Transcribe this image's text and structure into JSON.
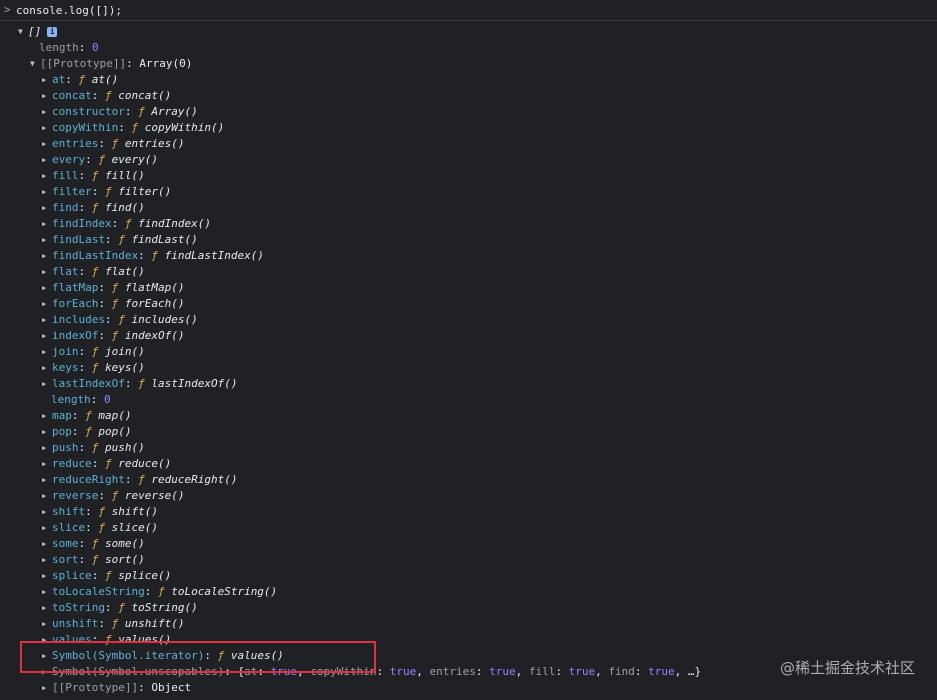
{
  "prompt_symbol": ">",
  "command": "console.log([]);",
  "root": {
    "label": "[]",
    "info_icon": "i"
  },
  "top_length": {
    "key": "length",
    "value": "0"
  },
  "prototype": {
    "key": "[[Prototype]]",
    "value": "Array(0)"
  },
  "methods": [
    {
      "key": "at",
      "fn": "at()"
    },
    {
      "key": "concat",
      "fn": "concat()"
    },
    {
      "key": "constructor",
      "fn": "Array()"
    },
    {
      "key": "copyWithin",
      "fn": "copyWithin()"
    },
    {
      "key": "entries",
      "fn": "entries()"
    },
    {
      "key": "every",
      "fn": "every()"
    },
    {
      "key": "fill",
      "fn": "fill()"
    },
    {
      "key": "filter",
      "fn": "filter()"
    },
    {
      "key": "find",
      "fn": "find()"
    },
    {
      "key": "findIndex",
      "fn": "findIndex()"
    },
    {
      "key": "findLast",
      "fn": "findLast()"
    },
    {
      "key": "findLastIndex",
      "fn": "findLastIndex()"
    },
    {
      "key": "flat",
      "fn": "flat()"
    },
    {
      "key": "flatMap",
      "fn": "flatMap()"
    },
    {
      "key": "forEach",
      "fn": "forEach()"
    },
    {
      "key": "includes",
      "fn": "includes()"
    },
    {
      "key": "indexOf",
      "fn": "indexOf()"
    },
    {
      "key": "join",
      "fn": "join()"
    },
    {
      "key": "keys",
      "fn": "keys()"
    },
    {
      "key": "lastIndexOf",
      "fn": "lastIndexOf()"
    }
  ],
  "inner_length": {
    "key": "length",
    "value": "0"
  },
  "methods2": [
    {
      "key": "map",
      "fn": "map()"
    },
    {
      "key": "pop",
      "fn": "pop()"
    },
    {
      "key": "push",
      "fn": "push()"
    },
    {
      "key": "reduce",
      "fn": "reduce()"
    },
    {
      "key": "reduceRight",
      "fn": "reduceRight()"
    },
    {
      "key": "reverse",
      "fn": "reverse()"
    },
    {
      "key": "shift",
      "fn": "shift()"
    },
    {
      "key": "slice",
      "fn": "slice()"
    },
    {
      "key": "some",
      "fn": "some()"
    },
    {
      "key": "sort",
      "fn": "sort()"
    },
    {
      "key": "splice",
      "fn": "splice()"
    },
    {
      "key": "toLocaleString",
      "fn": "toLocaleString()"
    },
    {
      "key": "toString",
      "fn": "toString()"
    },
    {
      "key": "unshift",
      "fn": "unshift()"
    },
    {
      "key": "values",
      "fn": "values()"
    }
  ],
  "symbol_iterator": {
    "key": "Symbol(Symbol.iterator)",
    "fn": "values()"
  },
  "symbol_unscopables": {
    "key": "Symbol(Symbol.unscopables)",
    "open": "{",
    "entries": [
      {
        "k": "at",
        "v": "true"
      },
      {
        "k": "copyWithin",
        "v": "true"
      },
      {
        "k": "entries",
        "v": "true"
      },
      {
        "k": "fill",
        "v": "true"
      },
      {
        "k": "find",
        "v": "true"
      }
    ],
    "tail": "…}"
  },
  "last_prototype": {
    "key": "[[Prototype]]",
    "value": "Object"
  },
  "f_glyph": "ƒ",
  "watermark": "@稀土掘金技术社区",
  "colors": {
    "background": "#202124",
    "key": "#5db0d7",
    "f": "#e8a94f",
    "number": "#9980ff",
    "highlight": "#e0313c"
  }
}
